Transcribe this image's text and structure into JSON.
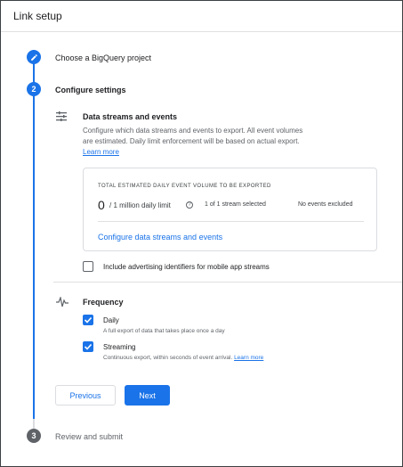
{
  "header": {
    "title": "Link setup"
  },
  "steps": [
    {
      "number": "",
      "label": "Choose a BigQuery project",
      "icon": "pencil-icon"
    },
    {
      "number": "2",
      "label": "Configure settings"
    },
    {
      "number": "3",
      "label": "Review and submit"
    }
  ],
  "data_streams": {
    "title": "Data streams and events",
    "description_line1": "Configure which data streams and events to export. All event volumes",
    "description_line2": "are estimated. Daily limit enforcement will be based on actual export.",
    "learn_more": "Learn more",
    "card": {
      "title": "TOTAL ESTIMATED DAILY EVENT VOLUME TO BE EXPORTED",
      "volume": "0",
      "limit": "/ 1 million daily limit",
      "streams_selected": "1 of 1 stream selected",
      "events_excluded": "No events excluded",
      "configure_link": "Configure data streams and events"
    },
    "advertising_checkbox": {
      "label": "Include advertising identifiers for mobile app streams",
      "checked": false
    }
  },
  "frequency": {
    "title": "Frequency",
    "daily": {
      "label": "Daily",
      "description": "A full export of data that takes place once a day",
      "checked": true
    },
    "streaming": {
      "label": "Streaming",
      "description": "Continuous export, within seconds of event arrival.",
      "learn_more": "Learn more",
      "checked": true
    }
  },
  "buttons": {
    "previous": "Previous",
    "next": "Next"
  },
  "colors": {
    "accent": "#1a73e8",
    "inactive_step": "#5f6368",
    "divider": "#e0e0e0"
  }
}
